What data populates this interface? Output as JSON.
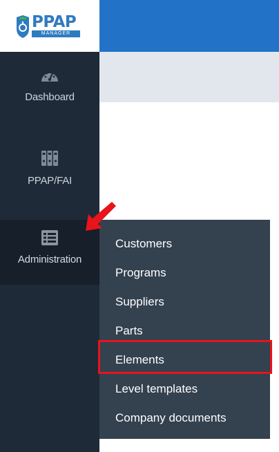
{
  "logo": {
    "text": "PPAP",
    "subtext": "MANAGER"
  },
  "sidebar": {
    "items": [
      {
        "label": "Dashboard",
        "icon": "dashboard-gauge-icon"
      },
      {
        "label": "PPAP/FAI",
        "icon": "binders-icon"
      },
      {
        "label": "Administration",
        "icon": "list-icon",
        "active": true
      }
    ]
  },
  "submenu": {
    "items": [
      {
        "label": "Customers"
      },
      {
        "label": "Programs"
      },
      {
        "label": "Suppliers"
      },
      {
        "label": "Parts"
      },
      {
        "label": "Elements",
        "highlighted": true
      },
      {
        "label": "Level templates"
      },
      {
        "label": "Company documents"
      }
    ]
  },
  "annotations": {
    "arrow": "red-arrow-icon",
    "highlight_color": "#e8131b"
  },
  "colors": {
    "sidebar": "#1f2a38",
    "sidebar_active": "#161f2a",
    "submenu": "#34414f",
    "topbar": "#2273c8",
    "brand": "#2f7bc0"
  }
}
